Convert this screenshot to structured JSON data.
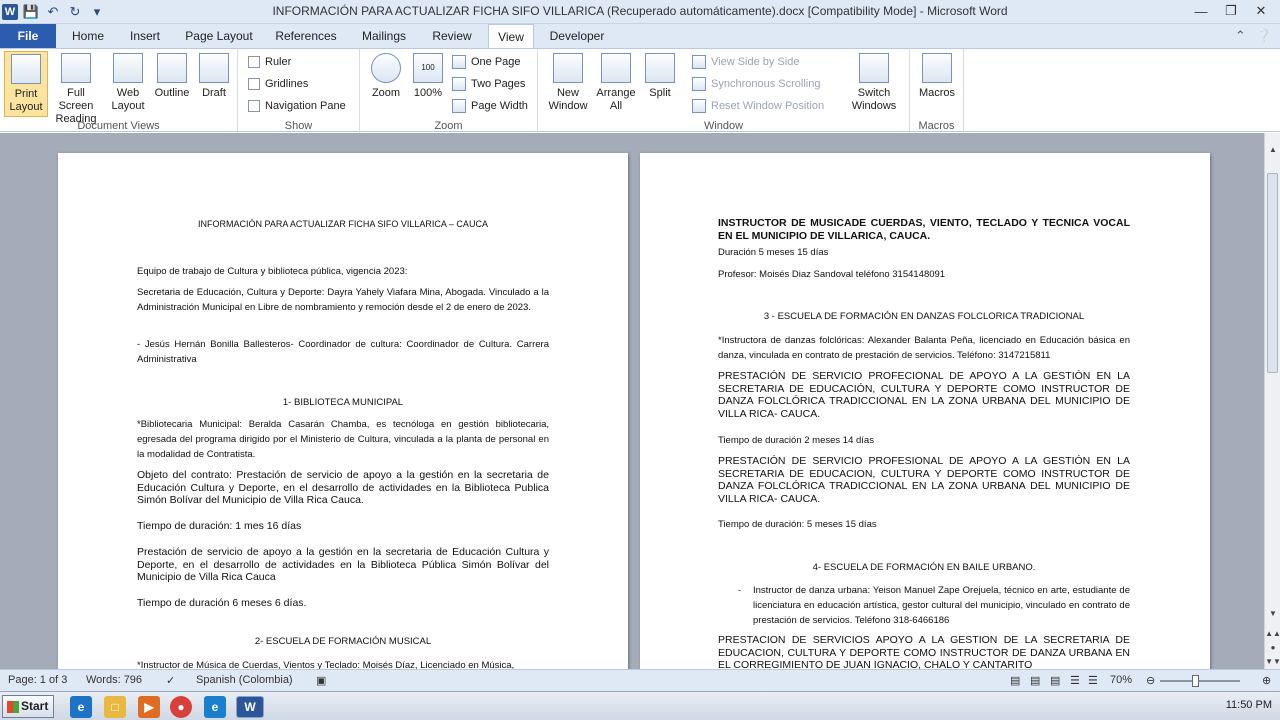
{
  "window": {
    "title": "INFORMACIÓN PARA ACTUALIZAR FICHA SIFO VILLARICA (Recuperado automáticamente).docx [Compatibility Mode] - Microsoft Word",
    "word_icon": "W"
  },
  "tabs": [
    "File",
    "Home",
    "Insert",
    "Page Layout",
    "References",
    "Mailings",
    "Review",
    "View",
    "Developer"
  ],
  "ribbon": {
    "document_views": {
      "label": "Document Views",
      "buttons": [
        "Print Layout",
        "Full Screen Reading",
        "Web Layout",
        "Outline",
        "Draft"
      ]
    },
    "show": {
      "label": "Show",
      "items": [
        "Ruler",
        "Gridlines",
        "Navigation Pane"
      ]
    },
    "zoom": {
      "label": "Zoom",
      "zoom_btn": "Zoom",
      "hundred_btn": "100%",
      "hundred_icon_text": "100",
      "one_page": "One Page",
      "two_pages": "Two Pages",
      "page_width": "Page Width"
    },
    "window": {
      "label": "Window",
      "new_window": "New Window",
      "arrange_all": "Arrange All",
      "split": "Split",
      "view_side_by_side": "View Side by Side",
      "synchronous_scrolling": "Synchronous Scrolling",
      "reset_window_position": "Reset Window Position",
      "switch_windows": "Switch Windows"
    },
    "macros": {
      "label": "Macros",
      "macros_btn": "Macros"
    }
  },
  "page1": {
    "title": "INFORMACIÓN PARA ACTUALIZAR FICHA SIFO VILLARICA – CAUCA",
    "p1": "Equipo de trabajo de Cultura y biblioteca pública, vigencia 2023:",
    "p2": "Secretaria de Educación, Cultura y Deporte: Dayra Yahely Viafara Mina, Abogada. Vinculado a la Administración Municipal en Libre de nombramiento y remoción desde el 2 de enero de 2023.",
    "p3": "- Jesús Hernán Bonilla Ballesteros- Coordinador de cultura: Coordinador de Cultura. Carrera Administrativa",
    "h1": "1- BIBLIOTECA MUNICIPAL",
    "p4": "*Bibliotecaria Municipal: Beralda Casarán Chamba, es tecnóloga en gestión bibliotecaria, egresada del programa dirigido por el Ministerio de Cultura, vinculada a la planta de personal en la modalidad de Contratista.",
    "p5": "Objeto del contrato: Prestación de servicio de apoyo a la gestión en la secretaria de Educación Cultura y Deporte, en el desarrollo de actividades en la Biblioteca Publica Simón Bolívar del Municipio de Villa Rica Cauca.",
    "p6": "Tiempo de duración:  1 mes 16 días",
    "p7": "Prestación de servicio de apoyo a la gestión en la secretaria de Educación Cultura y Deporte, en el desarrollo de actividades en la Biblioteca Pública Simón Bolívar del Municipio de Villa Rica Cauca",
    "p8": "Tiempo de duración 6 meses 6 días.",
    "h2": "2- ESCUELA DE FORMACIÓN MUSICAL",
    "p9": "*Instructor de Música de Cuerdas, Vientos y Teclado: Moisés Díaz, Licenciado en Música,"
  },
  "page2": {
    "heading": "INSTRUCTOR DE MUSICADE CUERDAS, VIENTO, TECLADO Y TECNICA VOCAL EN EL MUNICIPIO DE VILLARICA, CAUCA.",
    "p1": "Duración 5 meses 15 días",
    "p2": "Profesor: Moisés Diaz Sandoval  teléfono 3154148091",
    "h3": "3 - ESCUELA DE FORMACIÓN EN DANZAS FOLCLORICA TRADICIONAL",
    "p3": "*Instructora de danzas folclóricas: Alexander Balanta Peña, licenciado en Educación básica en danza, vinculada en contrato de prestación de servicios. Teléfono: 3147215811",
    "p4": "PRESTACIÓN DE SERVICIO PROFECIONAL DE APOYO A LA GESTIÓN EN LA SECRETARIA DE EDUCACIÓN, CULTURA Y DEPORTE COMO INSTRUCTOR DE DANZA FOLCLÓRICA TRADICCIONAL EN LA ZONA URBANA DEL MUNICIPIO DE VILLA RICA- CAUCA.",
    "p5": "Tiempo de duración 2 meses 14 días",
    "p6": "PRESTACIÓN DE SERVICIO PROFESIONAL DE APOYO A LA GESTIÓN EN LA SECRETARIA DE EDUCACION, CULTURA Y DEPORTE COMO INSTRUCTOR DE DANZA FOLCLÓRICA TRADICCIONAL EN LA ZONA URBANA DEL MUNICIPIO DE VILLA RICA- CAUCA.",
    "p7": "Tiempo de duración: 5 meses 15 días",
    "h4": "4- ESCUELA DE FORMACIÓN EN BAILE URBANO.",
    "p8": "Instructor de danza urbana: Yeison Manuel Zape Orejuela, técnico en arte, estudiante de licenciatura en educación artística, gestor cultural del municipio, vinculado en contrato de prestación de servicios. Teléfono 318-6466186",
    "p9": "PRESTACION DE SERVICIOS APOYO A LA GESTION DE LA SECRETARIA DE EDUCACION, CULTURA Y DEPORTE COMO INSTRUCTOR DE DANZA URBANA EN EL CORREGIMIENTO DE JUAN IGNACIO, CHALO Y CANTARITO"
  },
  "status": {
    "page": "Page: 1 of 3",
    "words": "Words: 796",
    "language": "Spanish (Colombia)",
    "zoom": "70%"
  },
  "taskbar": {
    "start": "Start",
    "time": "11:50 PM"
  },
  "colors": {
    "accent": "#2b5cad",
    "ribbon_bg": "#dfe9f5",
    "doc_bg": "#a4acb9"
  }
}
